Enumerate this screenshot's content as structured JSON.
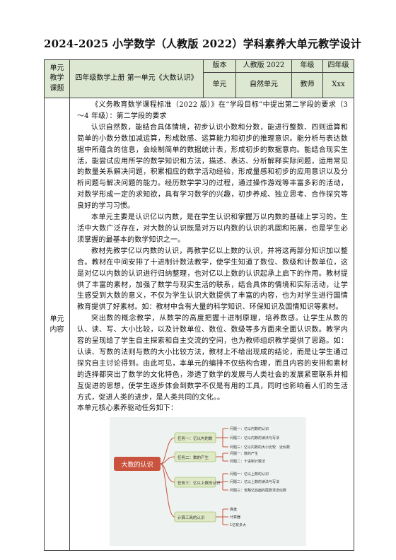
{
  "title": "2024-2025 小学数学（人教版 2022）学科素养大单元教学设计",
  "header": {
    "unit_label": "单元教学课题",
    "unit_label_lines": [
      "单元",
      "教学",
      "课题"
    ],
    "topic": "四年级数学上册 第一单元《大数认识》",
    "edition_label": "版本",
    "edition_value": "人教版 2022",
    "grade_label": "年级",
    "grade_value": "四年级",
    "unit_type_label": "单元",
    "unit_type_value": "自然单元",
    "teacher_label": "教师",
    "teacher_value": "Xxx"
  },
  "content": {
    "label_lines": [
      "单元",
      "内容"
    ],
    "paragraphs": [
      "《义务教育数学课程标准（2022 版）》在“学段目标”中提出第二学段的要求（3～4 年级）：第二学段的要求",
      "认识自然数，能结合具体情境，初步认识小数和分数，能进行整数、四则运算和简单的小数分数加减运算，形成数感、运算能力和初步的推理意识。能分析与表达数据中所蕴含的信息，会绘制简单的数据统计表，形成初步的数据意向。能结合现实生活，能尝试应用所学的数学知识和方法，描述、表达、分析解释实际问题，运用常见的数量关系解决问题，积累相应的数学活动经验，形成量感和初步的应用意识以及分析问题与解决问题的能力。经历数学学习的过程，通过操作游戏等丰富多彩的活动，对数学形成一定的求知欲，具有学习数学的兴趣，初步养成、独立思考、合作探究等良好的学习习惯。",
      "本单元主要是认识亿以内数，是在学生认识和掌握万以内数的基础上学习的。生活中大数广泛存在，对大数的认识既是对万以内数的认识的巩固和拓展，也是学生必须掌握的最基本的数学知识之一。",
      "教材先教学亿以内数的认识，再教学亿以上数的认识，并将这两部分知识加以整合。教材在中间安排了十进制计数法教学，使学生知道了数位、数级和计数单位，这是对亿以内数的认识进行归纳整理，也对亿以上数的认识起承上启下的作用。教材提供了丰富的素材，加强了数学与现实生活的联系，结合具体的情境和实际活动，让学生感受到大数的意义，不仅为学生认识大数提供了丰富的内容，也为对学生进行国情教育提供了好素材。如：教材中含有大量的科学知识、环保知识及国情知识等素材。",
      "突出数的概念教学，从数学的高度把握十进制原理，培养数感。让学生从数的认、读、写、大小比较，以及计数单位、数位、数级等多方面来全面认识数。教学内容的呈现给了学生自主探索和自主交流的空间，也为教师组织教学提供了思路。如：认读、写数的法则与数的大小比较方法，教材上不给出现成的结论，而是让学生通过探究自主讨论得到。由此可见，本单元的编排不仅结构合理，而且内容的安排和素材的选择都突出了数学的文化特色，渗透了数学的发展与人类社会的发展紧密联系并相互促进的思想，使学生逐步体会到数学不仅是有用的工具，同时也影响着人们的生活方式，促进人类的进步，是人类共同的文化。。",
      "本单元核心素养驱动任务如下："
    ]
  },
  "mindmap": {
    "root": "大数的认识",
    "tasks": [
      {
        "label": "任务一：亿以内的数",
        "items": [
          "问题一：亿以内数的认识",
          "问题二：亿以内数的读法与写法",
          "问题三：亿以内数的大小比较　近似数"
        ]
      },
      {
        "label": "任务二：数的产生",
        "items": [
          "问题一：数的产生",
          "问题二：十进制计数法"
        ]
      },
      {
        "label": "任务三：亿以上数的认识",
        "items": [
          "问题一：亿以上数的认识",
          "问题二：亿以上数的读法与写法",
          "问题三：省略亿后面的尾数求近似数"
        ]
      },
      {
        "label": "计算工具的认识",
        "items": [
          "算盘",
          "计算器",
          "1亿有多大"
        ]
      }
    ]
  },
  "colors": {
    "header_bg": "#dce8d1",
    "border": "#444444",
    "mindmap_bg": "#eef3f1",
    "root_bg": "#c9533f",
    "task_bg": "#dfe9c6",
    "task_border": "#8fb04a",
    "line": "#c9533f"
  }
}
